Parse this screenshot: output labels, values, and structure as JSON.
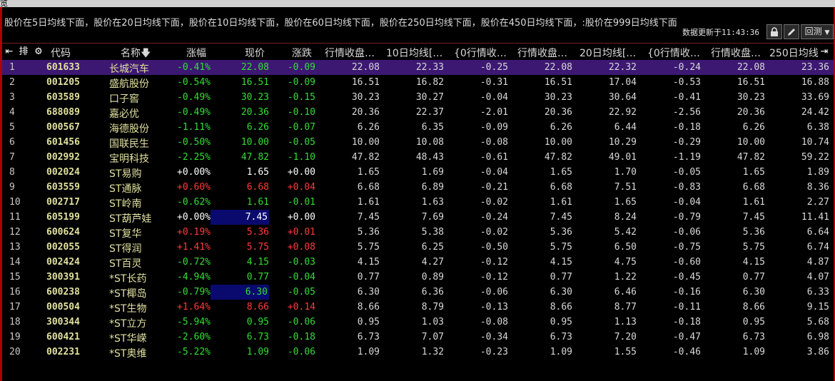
{
  "criteria": "股价在5日均线下面，股价在20日均线下面，股价在10日均线下面，股价在60日均线下面，股价在250日均线下面，股价在450日均线下面，:股价在999日均线下面",
  "update_label": "数据更新于",
  "update_time": "11:43:36",
  "buttons": {
    "back": "回测"
  },
  "columns": [
    "代码",
    "名称",
    "涨幅",
    "现价",
    "涨跌",
    "行情收盘…",
    "10日均线[…",
    "{0行情收…",
    "行情收盘…",
    "20日均线[…",
    "{0行情收…",
    "行情收盘…",
    "250日均线"
  ],
  "sort_indicator": "arrow-down",
  "colors": {
    "up": "#ff3a3a",
    "down": "#33dd33",
    "selected_row": "#3c1873",
    "highlight": "#0a0a6e"
  },
  "rows": [
    {
      "idx": "1",
      "code": "601633",
      "name": "长城汽车",
      "pct": "-0.41%",
      "price": "22.08",
      "chg": "-0.09",
      "v1": "22.08",
      "v2": "22.33",
      "v3": "-0.25",
      "v4": "22.08",
      "v5": "22.32",
      "v6": "-0.24",
      "v7": "22.08",
      "v8": "23.36",
      "dir": "dn"
    },
    {
      "idx": "2",
      "code": "001205",
      "name": "盛航股份",
      "pct": "-0.54%",
      "price": "16.51",
      "chg": "-0.09",
      "v1": "16.51",
      "v2": "16.82",
      "v3": "-0.31",
      "v4": "16.51",
      "v5": "17.04",
      "v6": "-0.53",
      "v7": "16.51",
      "v8": "16.88",
      "dir": "dn"
    },
    {
      "idx": "3",
      "code": "603589",
      "name": "口子窖",
      "pct": "-0.49%",
      "price": "30.23",
      "chg": "-0.15",
      "v1": "30.23",
      "v2": "30.27",
      "v3": "-0.04",
      "v4": "30.23",
      "v5": "30.64",
      "v6": "-0.41",
      "v7": "30.23",
      "v8": "33.69",
      "dir": "dn"
    },
    {
      "idx": "4",
      "code": "688089",
      "name": "嘉必优",
      "pct": "-0.49%",
      "price": "20.36",
      "chg": "-0.10",
      "v1": "20.36",
      "v2": "22.37",
      "v3": "-2.01",
      "v4": "20.36",
      "v5": "22.92",
      "v6": "-2.56",
      "v7": "20.36",
      "v8": "24.42",
      "dir": "dn"
    },
    {
      "idx": "5",
      "code": "000567",
      "name": "海德股份",
      "pct": "-1.11%",
      "price": "6.26",
      "chg": "-0.07",
      "v1": "6.26",
      "v2": "6.35",
      "v3": "-0.09",
      "v4": "6.26",
      "v5": "6.44",
      "v6": "-0.18",
      "v7": "6.26",
      "v8": "6.38",
      "dir": "dn"
    },
    {
      "idx": "6",
      "code": "601456",
      "name": "国联民生",
      "pct": "-0.50%",
      "price": "10.00",
      "chg": "-0.05",
      "v1": "10.00",
      "v2": "10.08",
      "v3": "-0.08",
      "v4": "10.00",
      "v5": "10.29",
      "v6": "-0.29",
      "v7": "10.00",
      "v8": "10.74",
      "dir": "dn"
    },
    {
      "idx": "7",
      "code": "002992",
      "name": "宝明科技",
      "pct": "-2.25%",
      "price": "47.82",
      "chg": "-1.10",
      "v1": "47.82",
      "v2": "48.43",
      "v3": "-0.61",
      "v4": "47.82",
      "v5": "49.01",
      "v6": "-1.19",
      "v7": "47.82",
      "v8": "59.22",
      "dir": "dn"
    },
    {
      "idx": "8",
      "code": "002024",
      "name": "ST易购",
      "pct": "+0.00%",
      "price": "1.65",
      "chg": "+0.00",
      "v1": "1.65",
      "v2": "1.69",
      "v3": "-0.04",
      "v4": "1.65",
      "v5": "1.70",
      "v6": "-0.05",
      "v7": "1.65",
      "v8": "1.89",
      "dir": "flat"
    },
    {
      "idx": "9",
      "code": "603559",
      "name": "ST通脉",
      "pct": "+0.60%",
      "price": "6.68",
      "chg": "+0.04",
      "v1": "6.68",
      "v2": "6.89",
      "v3": "-0.21",
      "v4": "6.68",
      "v5": "7.51",
      "v6": "-0.83",
      "v7": "6.68",
      "v8": "8.36",
      "dir": "up"
    },
    {
      "idx": "10",
      "code": "002717",
      "name": "ST岭南",
      "pct": "-0.62%",
      "price": "1.61",
      "chg": "-0.01",
      "v1": "1.61",
      "v2": "1.63",
      "v3": "-0.02",
      "v4": "1.61",
      "v5": "1.65",
      "v6": "-0.04",
      "v7": "1.61",
      "v8": "2.27",
      "dir": "dn"
    },
    {
      "idx": "11",
      "code": "605199",
      "name": "ST葫芦娃",
      "pct": "+0.00%",
      "price": "7.45",
      "chg": "+0.00",
      "v1": "7.45",
      "v2": "7.69",
      "v3": "-0.24",
      "v4": "7.45",
      "v5": "8.24",
      "v6": "-0.79",
      "v7": "7.45",
      "v8": "11.41",
      "dir": "flat",
      "hl": true
    },
    {
      "idx": "12",
      "code": "600624",
      "name": "ST复华",
      "pct": "+0.19%",
      "price": "5.36",
      "chg": "+0.01",
      "v1": "5.36",
      "v2": "5.38",
      "v3": "-0.02",
      "v4": "5.36",
      "v5": "5.42",
      "v6": "-0.06",
      "v7": "5.36",
      "v8": "6.64",
      "dir": "up"
    },
    {
      "idx": "13",
      "code": "002055",
      "name": "ST得润",
      "pct": "+1.41%",
      "price": "5.75",
      "chg": "+0.08",
      "v1": "5.75",
      "v2": "6.25",
      "v3": "-0.50",
      "v4": "5.75",
      "v5": "6.50",
      "v6": "-0.75",
      "v7": "5.75",
      "v8": "6.74",
      "dir": "up"
    },
    {
      "idx": "14",
      "code": "002424",
      "name": "ST百灵",
      "pct": "-0.72%",
      "price": "4.15",
      "chg": "-0.03",
      "v1": "4.15",
      "v2": "4.27",
      "v3": "-0.12",
      "v4": "4.15",
      "v5": "4.75",
      "v6": "-0.60",
      "v7": "4.15",
      "v8": "4.87",
      "dir": "dn"
    },
    {
      "idx": "15",
      "code": "300391",
      "name": "*ST长药",
      "pct": "-4.94%",
      "price": "0.77",
      "chg": "-0.04",
      "v1": "0.77",
      "v2": "0.89",
      "v3": "-0.12",
      "v4": "0.77",
      "v5": "1.22",
      "v6": "-0.45",
      "v7": "0.77",
      "v8": "4.07",
      "dir": "dn"
    },
    {
      "idx": "16",
      "code": "600238",
      "name": "*ST椰岛",
      "pct": "-0.79%",
      "price": "6.30",
      "chg": "-0.05",
      "v1": "6.30",
      "v2": "6.36",
      "v3": "-0.06",
      "v4": "6.30",
      "v5": "6.46",
      "v6": "-0.16",
      "v7": "6.30",
      "v8": "6.33",
      "dir": "dn",
      "hl": true
    },
    {
      "idx": "17",
      "code": "000504",
      "name": "*ST生物",
      "pct": "+1.64%",
      "price": "8.66",
      "chg": "+0.14",
      "v1": "8.66",
      "v2": "8.79",
      "v3": "-0.13",
      "v4": "8.66",
      "v5": "8.77",
      "v6": "-0.11",
      "v7": "8.66",
      "v8": "9.15",
      "dir": "up"
    },
    {
      "idx": "18",
      "code": "300344",
      "name": "*ST立方",
      "pct": "-5.94%",
      "price": "0.95",
      "chg": "-0.06",
      "v1": "0.95",
      "v2": "1.03",
      "v3": "-0.08",
      "v4": "0.95",
      "v5": "1.13",
      "v6": "-0.18",
      "v7": "0.95",
      "v8": "5.68",
      "dir": "dn"
    },
    {
      "idx": "19",
      "code": "600421",
      "name": "*ST华嵘",
      "pct": "-2.60%",
      "price": "6.73",
      "chg": "-0.18",
      "v1": "6.73",
      "v2": "7.07",
      "v3": "-0.34",
      "v4": "6.73",
      "v5": "7.20",
      "v6": "-0.47",
      "v7": "6.73",
      "v8": "6.98",
      "dir": "dn"
    },
    {
      "idx": "20",
      "code": "002231",
      "name": "*ST奥维",
      "pct": "-5.22%",
      "price": "1.09",
      "chg": "-0.06",
      "v1": "1.09",
      "v2": "1.32",
      "v3": "-0.23",
      "v4": "1.09",
      "v5": "1.55",
      "v6": "-0.46",
      "v7": "1.09",
      "v8": "3.86",
      "dir": "dn"
    }
  ]
}
